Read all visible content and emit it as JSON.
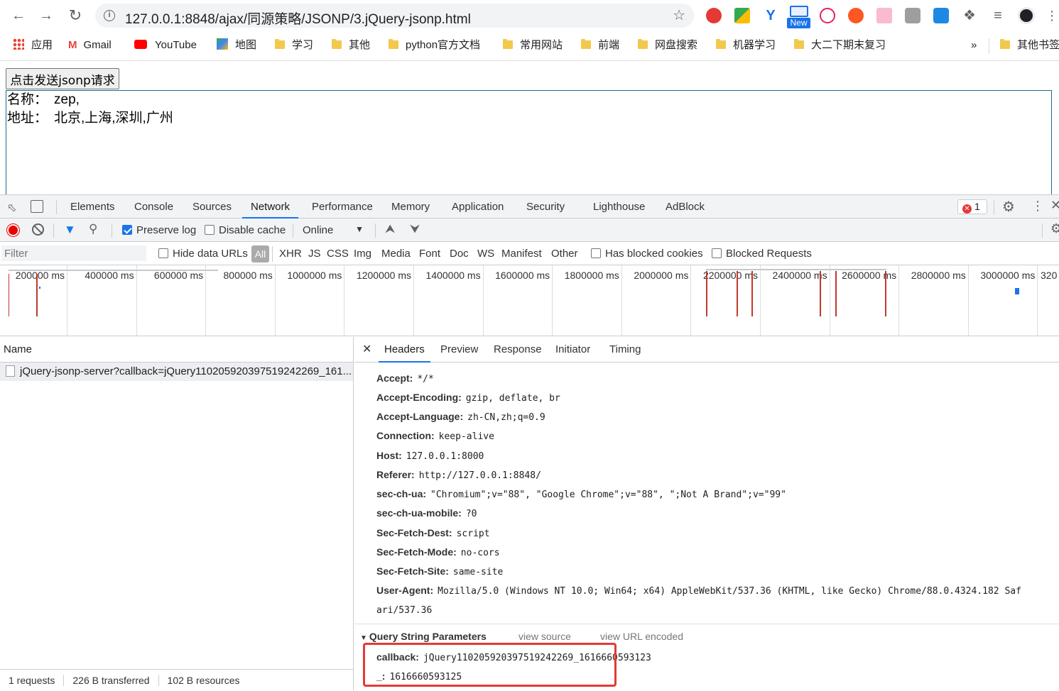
{
  "browser": {
    "url": "127.0.0.1:8848/ajax/同源策略/JSONP/3.jQuery-jsonp.html",
    "new_badge": "New",
    "bookmarks": [
      "应用",
      "Gmail",
      "YouTube",
      "地图",
      "学习",
      "其他",
      "python官方文档",
      "常用网站",
      "前端",
      "网盘搜索",
      "机器学习",
      "大二下期末复习"
    ],
    "bookmarks_overflow": "»",
    "other_bookmarks": "其他书签"
  },
  "page": {
    "button_label": "点击发送jsonp请求",
    "result": [
      {
        "key": "名称：",
        "value": "zep,"
      },
      {
        "key": "地址：",
        "value": "北京,上海,深圳,广州"
      }
    ]
  },
  "devtools": {
    "tabs": [
      "Elements",
      "Console",
      "Sources",
      "Network",
      "Performance",
      "Memory",
      "Application",
      "Security",
      "Lighthouse",
      "AdBlock"
    ],
    "active_tab": "Network",
    "error_count": "1",
    "toolbar": {
      "preserve_log": "Preserve log",
      "disable_cache": "Disable cache",
      "throttle": "Online"
    },
    "filter": {
      "placeholder": "Filter",
      "hide_data_urls": "Hide data URLs",
      "types": [
        "All",
        "XHR",
        "JS",
        "CSS",
        "Img",
        "Media",
        "Font",
        "Doc",
        "WS",
        "Manifest",
        "Other"
      ],
      "has_blocked_cookies": "Has blocked cookies",
      "blocked_requests": "Blocked Requests"
    },
    "timeline_ticks": [
      "200000 ms",
      "400000 ms",
      "600000 ms",
      "800000 ms",
      "1000000 ms",
      "1200000 ms",
      "1400000 ms",
      "1600000 ms",
      "1800000 ms",
      "2000000 ms",
      "2200000 ms",
      "2400000 ms",
      "2600000 ms",
      "2800000 ms",
      "3000000 ms",
      "320"
    ],
    "requests": {
      "column_name": "Name",
      "rows": [
        "jQuery-jsonp-server?callback=jQuery110205920397519242269_161..."
      ]
    },
    "status": {
      "requests": "1 requests",
      "transferred": "226 B transferred",
      "resources": "102 B resources"
    },
    "detail_tabs": [
      "Headers",
      "Preview",
      "Response",
      "Initiator",
      "Timing"
    ],
    "active_detail_tab": "Headers",
    "headers": [
      {
        "name": "Accept:",
        "value": "*/*"
      },
      {
        "name": "Accept-Encoding:",
        "value": "gzip, deflate, br"
      },
      {
        "name": "Accept-Language:",
        "value": "zh-CN,zh;q=0.9"
      },
      {
        "name": "Connection:",
        "value": "keep-alive"
      },
      {
        "name": "Host:",
        "value": "127.0.0.1:8000"
      },
      {
        "name": "Referer:",
        "value": "http://127.0.0.1:8848/"
      },
      {
        "name": "sec-ch-ua:",
        "value": "\"Chromium\";v=\"88\", \"Google Chrome\";v=\"88\", \";Not A Brand\";v=\"99\""
      },
      {
        "name": "sec-ch-ua-mobile:",
        "value": "?0"
      },
      {
        "name": "Sec-Fetch-Dest:",
        "value": "script"
      },
      {
        "name": "Sec-Fetch-Mode:",
        "value": "no-cors"
      },
      {
        "name": "Sec-Fetch-Site:",
        "value": "same-site"
      },
      {
        "name": "User-Agent:",
        "value": "Mozilla/5.0 (Windows NT 10.0; Win64; x64) AppleWebKit/537.36 (KHTML, like Gecko) Chrome/88.0.4324.182 Saf"
      }
    ],
    "user_agent_wrap": "ari/537.36",
    "query_string": {
      "title": "Query String Parameters",
      "view_source": "view source",
      "view_url_encoded": "view URL encoded",
      "params": [
        {
          "name": "callback:",
          "value": "jQuery110205920397519242269_1616660593123"
        },
        {
          "name": "_:",
          "value": "1616660593125"
        }
      ]
    }
  }
}
